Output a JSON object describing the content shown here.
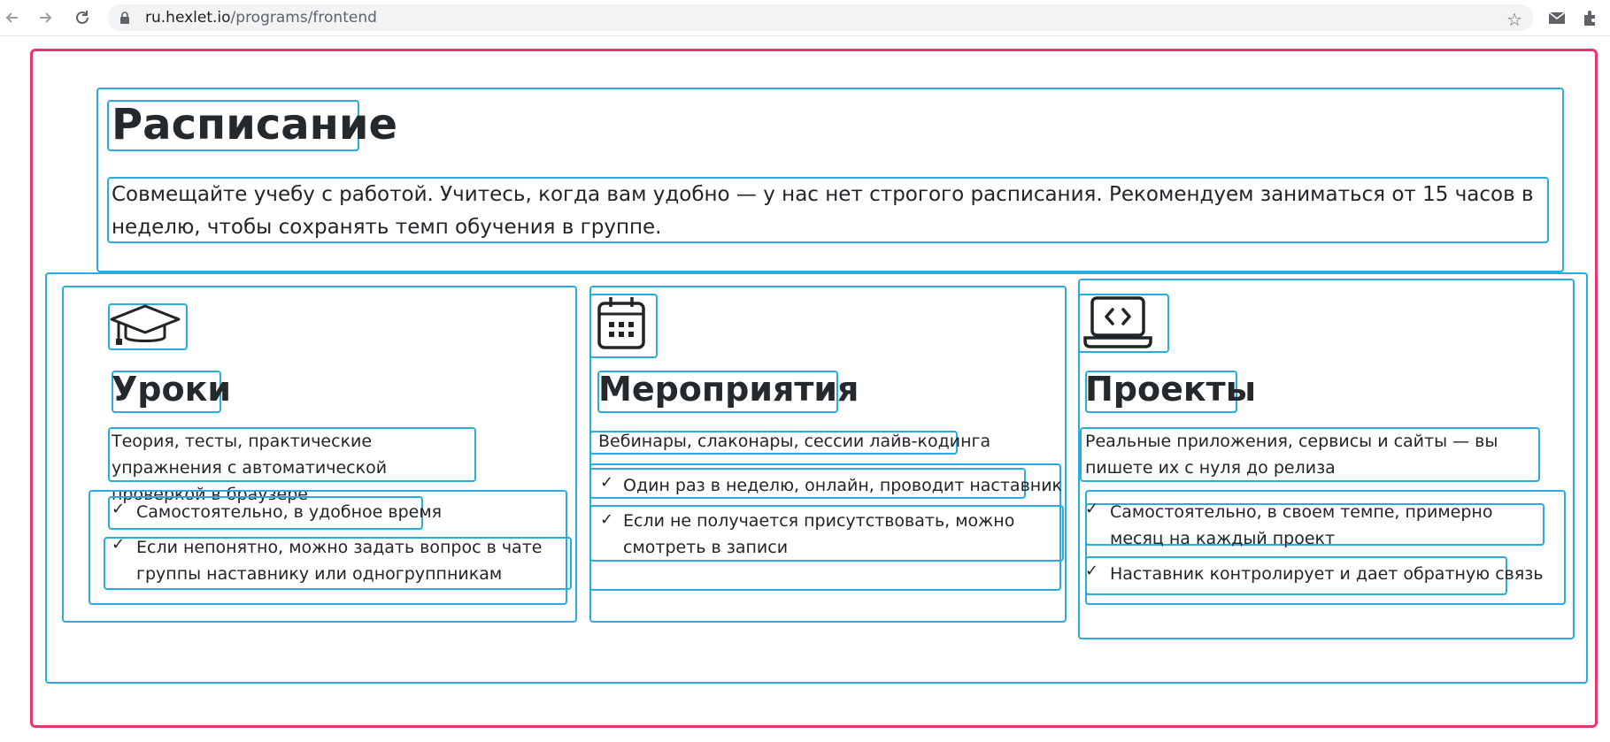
{
  "browser": {
    "url_domain": "ru.hexlet.io",
    "url_path": "/programs/frontend",
    "back_icon": "arrow-left",
    "forward_icon": "arrow-right",
    "reload_icon": "reload",
    "lock_icon": "lock",
    "star_icon": "star",
    "mail_icon": "mail",
    "extensions_icon": "puzzle"
  },
  "schedule": {
    "title": "Расписание",
    "lead": "Совмещайте учебу с работой. Учитесь, когда вам удобно — у нас нет строгого расписания. Рекомендуем заниматься от 15 часов в неделю, чтобы сохранять темп обучения в группе."
  },
  "cards": [
    {
      "icon": "graduation-cap",
      "title": "Уроки",
      "description": "Теория, тесты, практические упражнения с автоматической проверкой в браузере",
      "items": [
        "Самостоятельно, в удобное время",
        "Если непонятно, можно задать вопрос в чате группы наставнику или одногруппникам"
      ]
    },
    {
      "icon": "calendar",
      "title": "Мероприятия",
      "description": "Вебинары, слаконары, сессии лайв-кодинга",
      "items": [
        "Один раз в неделю, онлайн, проводит наставник",
        "Если не получается присутствовать, можно смотреть в записи"
      ]
    },
    {
      "icon": "laptop-code",
      "title": "Проекты",
      "description": "Реальные приложения, сервисы и сайты — вы пишете их с нуля до релиза",
      "items": [
        "Самостоятельно, в своем темпе, примерно месяц на каждый проект",
        "Наставник контролирует и дает обратную связь"
      ]
    }
  ],
  "colors": {
    "outline_outer": "#e8366a",
    "outline_inner": "#29abe2",
    "text": "#212529"
  }
}
